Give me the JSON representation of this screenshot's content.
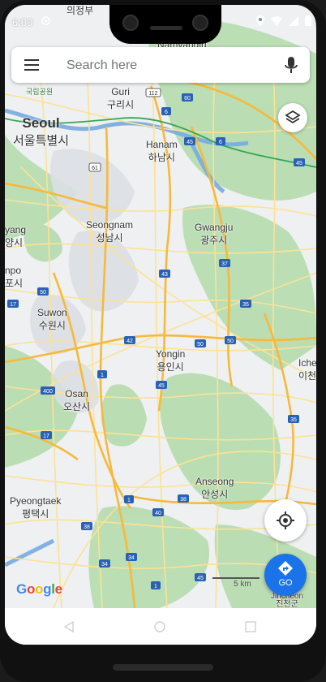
{
  "status_bar": {
    "time": "6:00"
  },
  "search": {
    "placeholder": "Search here"
  },
  "map": {
    "cities": [
      {
        "name": "Seoul",
        "native": "서울특별시"
      },
      {
        "name": "Guri",
        "native": "구리시"
      },
      {
        "name": "Hanam",
        "native": "하남시"
      },
      {
        "name": "Seongnam",
        "native": "성남시"
      },
      {
        "name": "Gwangju",
        "native": "광주시"
      },
      {
        "name": "Suwon",
        "native": "수원시"
      },
      {
        "name": "Yongin",
        "native": "용인시"
      },
      {
        "name": "Osan",
        "native": "오산시"
      },
      {
        "name": "Anseong",
        "native": "안성시"
      },
      {
        "name": "Pyeongtaek",
        "native": "평택시"
      },
      {
        "name": "Jincheon",
        "native": "진천군"
      }
    ],
    "edge_labels": {
      "top_left": "의정부",
      "top_namyangju": "Namyangju",
      "park": "국립공원",
      "left_yang": "yang",
      "left_yang_native": "양시",
      "left_po": "npo",
      "left_po_native": "포시",
      "right_iche": "Iche",
      "right_iche_native": "이천"
    },
    "route_shields": [
      "45",
      "112",
      "60",
      "6",
      "6",
      "61",
      "45",
      "37",
      "43",
      "50",
      "17",
      "35",
      "42",
      "50",
      "1",
      "50",
      "400",
      "45",
      "17",
      "35",
      "1",
      "38",
      "40",
      "1",
      "38",
      "34",
      "34",
      "1",
      "45"
    ],
    "scale_label": "5 km",
    "attribution": "Google"
  },
  "controls": {
    "go_label": "GO"
  },
  "colors": {
    "accent": "#1a73e8",
    "land": "#e8ecef",
    "park_green": "#a8d5a2",
    "water": "#7baee0",
    "highway": "#f6c35b",
    "road_yellow": "#fde293"
  },
  "icons": [
    "menu-icon",
    "mic-icon",
    "layers-icon",
    "my-location-icon",
    "directions-icon"
  ]
}
